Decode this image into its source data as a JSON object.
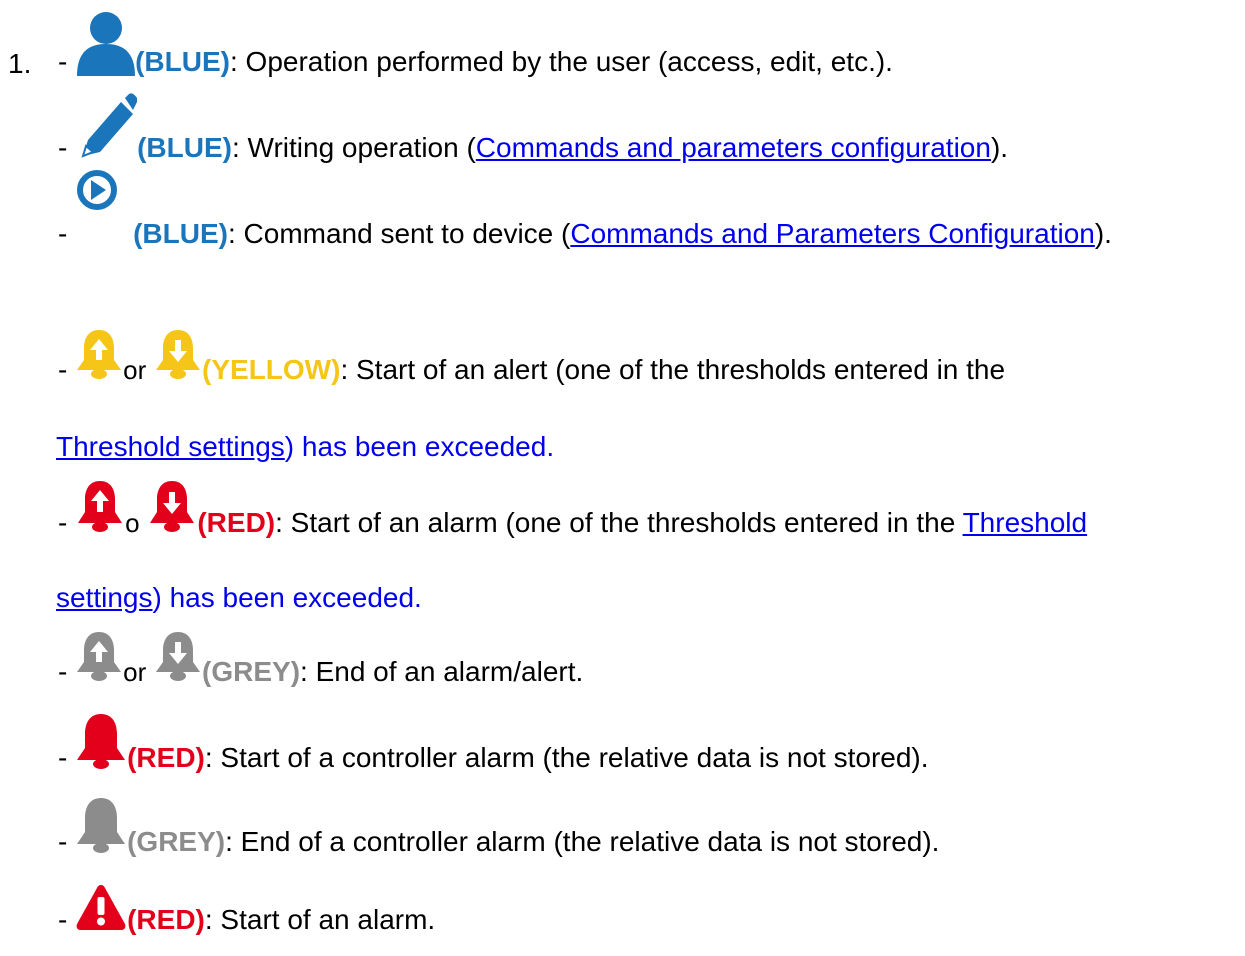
{
  "list_number": "1.",
  "dash": "-",
  "colors": {
    "blue": "#1b75bb",
    "yellow": "#f5c518",
    "red": "#e2001a",
    "grey": "#8c8c8c",
    "link": "#0000ee",
    "text": "#000000"
  },
  "items": [
    {
      "icons": [
        "user-icon"
      ],
      "tag": "(BLUE)",
      "text": ": Operation performed by the user (access, edit, etc.)."
    },
    {
      "icons": [
        "pencil-icon"
      ],
      "tag": "(BLUE)",
      "text_before": ": Writing operation (",
      "link": "Commands and parameters configuration",
      "text_after": ")."
    },
    {
      "icons": [
        "play-circle-icon"
      ],
      "tag": "(BLUE)",
      "text_before": ": Command sent to device (",
      "link": "Commands and Parameters Configuration",
      "text_after": ")."
    },
    {
      "icons": [
        "bell-arrow-up-icon",
        "bell-arrow-down-icon"
      ],
      "connector": "or",
      "tag": "(YELLOW)",
      "text": ": Start of an alert (one of the thresholds entered in the",
      "link": "Threshold settings",
      "text_after": ") has been exceeded."
    },
    {
      "icons": [
        "bell-arrow-up-icon",
        "bell-arrow-down-icon"
      ],
      "connector": "o",
      "tag": "(RED)",
      "text": ": Start of an alarm (one of the thresholds entered in the ",
      "link_part1": "Threshold",
      "link_part2": "settings",
      "text_after": ") has been exceeded."
    },
    {
      "icons": [
        "bell-arrow-up-icon",
        "bell-arrow-down-icon"
      ],
      "connector": "or",
      "tag": "(GREY)",
      "text": ": End of an alarm/alert."
    },
    {
      "icons": [
        "bell-icon"
      ],
      "tag": "(RED)",
      "text": ": Start of a controller alarm (the relative data is not stored)."
    },
    {
      "icons": [
        "bell-icon"
      ],
      "tag": "(GREY)",
      "text": ": End of a controller alarm (the relative data is not stored)."
    },
    {
      "icons": [
        "warning-triangle-icon"
      ],
      "tag": "(RED)",
      "text": ": Start of an alarm."
    }
  ]
}
